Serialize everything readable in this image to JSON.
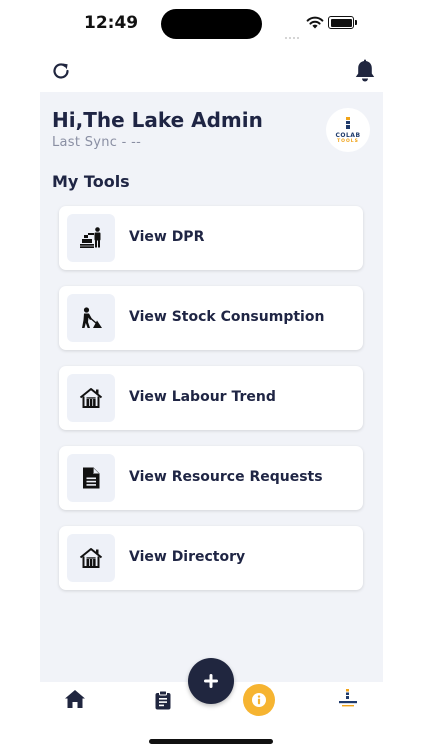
{
  "status_bar": {
    "time": "12:49"
  },
  "header": {
    "greeting": "Hi,The Lake Admin",
    "last_sync": "Last Sync - --",
    "logo_text": "COLAB",
    "logo_subtext": "TOOLS"
  },
  "section_title": "My Tools",
  "tools": [
    {
      "label": "View DPR",
      "icon": "construction-worker-bricks-icon"
    },
    {
      "label": "View Stock Consumption",
      "icon": "digging-worker-icon"
    },
    {
      "label": "View Labour Trend",
      "icon": "house-icon"
    },
    {
      "label": "View Resource Requests",
      "icon": "document-icon"
    },
    {
      "label": "View Directory",
      "icon": "house-icon"
    }
  ],
  "bottom_nav": {
    "items": [
      "home-icon",
      "clipboard-icon",
      "add-icon",
      "info-icon",
      "colab-logo-icon"
    ]
  },
  "colors": {
    "primary": "#1f2544",
    "panel_bg": "#f1f3f8",
    "accent": "#f6b431",
    "muted": "#8a8fa3"
  }
}
